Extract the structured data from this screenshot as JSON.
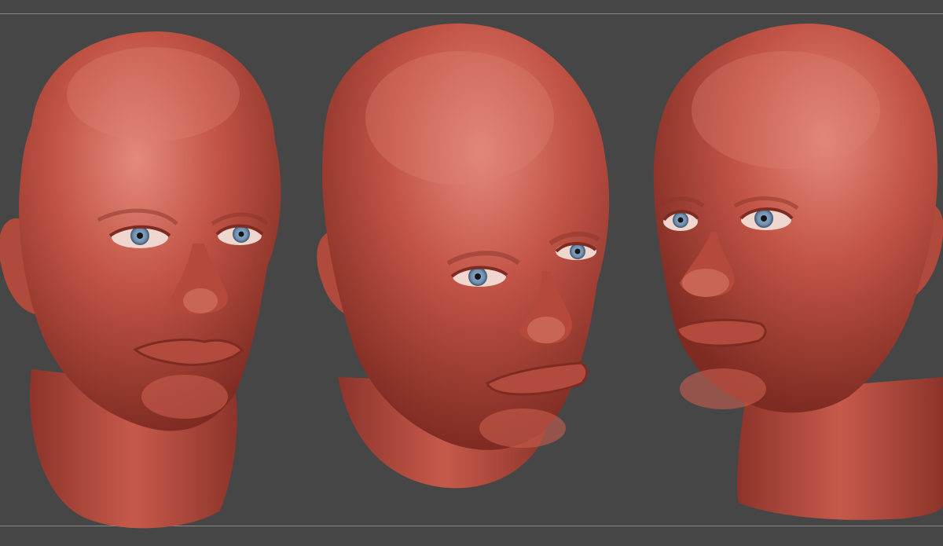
{
  "canvas": {
    "background": "#464646",
    "guide_line_color": "#8a8a8a"
  },
  "material": {
    "skin_color": "#c25446",
    "skin_highlight": "#e48a7b",
    "skin_shadow": "#7e2b22",
    "iris_color": "#6f8faf",
    "pupil_color": "#141414"
  },
  "views": [
    {
      "name": "head-view-front-left"
    },
    {
      "name": "head-view-three-quarter-down"
    },
    {
      "name": "head-view-three-quarter-right"
    }
  ]
}
